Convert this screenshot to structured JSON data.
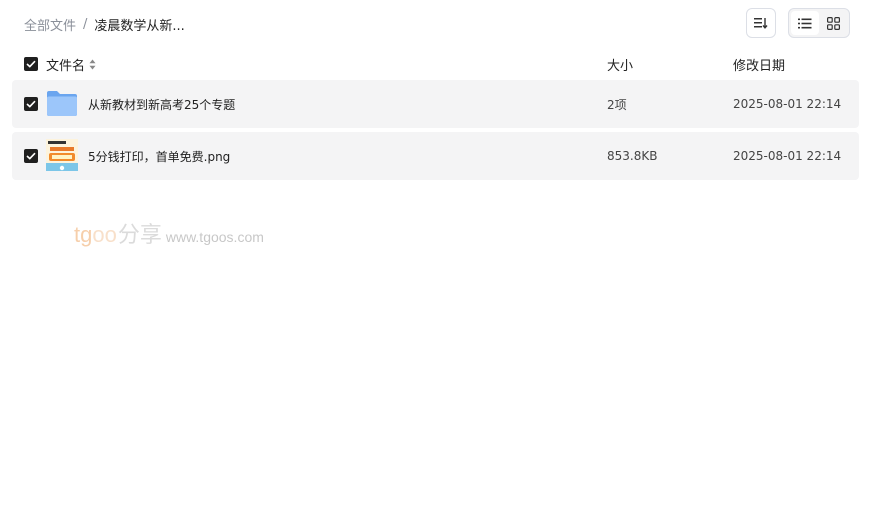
{
  "breadcrumb": {
    "root": "全部文件",
    "separator": "/",
    "current": "凌晨数学从新..."
  },
  "toolbar": {
    "sort_icon": "sort-list-icon",
    "list_icon": "list-view-icon",
    "grid_icon": "grid-view-icon",
    "active_view": "list"
  },
  "columns": {
    "name": "文件名",
    "size": "大小",
    "date": "修改日期"
  },
  "files": [
    {
      "name": "从新教材到新高考25个专题",
      "size": "2项",
      "date": "2025-08-01 22:14",
      "type": "folder",
      "checked": true
    },
    {
      "name": "5分钱打印，首单免费.png",
      "size": "853.8KB",
      "date": "2025-08-01 22:14",
      "type": "image",
      "checked": true
    }
  ],
  "watermark": {
    "brand_t": "tg",
    "brand_oo": "oo",
    "brand_cn": "分享",
    "url": "www.tgoos.com"
  },
  "colors": {
    "row_bg": "#f4f4f5",
    "checkbox": "#1f1f1f",
    "folder": "#7fb3f5",
    "muted_text": "#8a8f99"
  }
}
